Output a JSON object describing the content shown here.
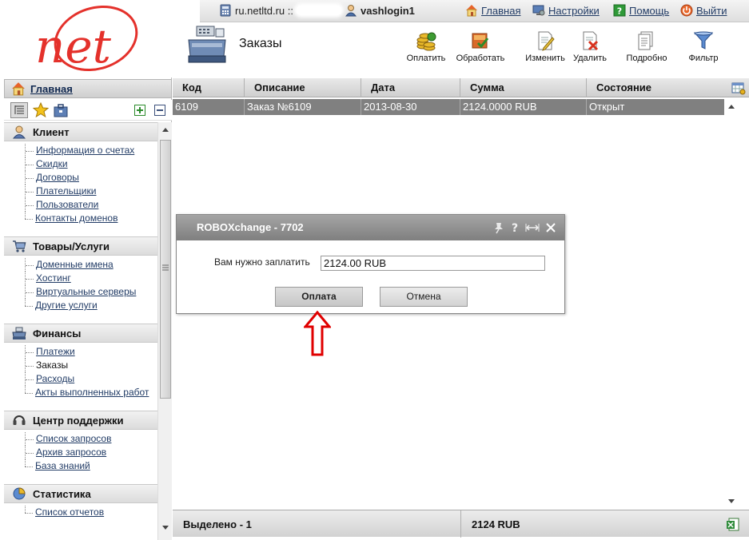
{
  "topbar": {
    "host": "ru.netltd.ru ::",
    "login": "vashlogin1",
    "home": "Главная",
    "settings": "Настройки",
    "help": "Помощь",
    "logout": "Выйти"
  },
  "page": {
    "title": "Заказы"
  },
  "toolbar": {
    "pay": "Оплатить",
    "process": "Обработать",
    "edit": "Изменить",
    "delete": "Удалить",
    "details": "Подробно",
    "filter": "Фильтр"
  },
  "sidebar": {
    "home": "Главная",
    "sections": [
      {
        "title": "Клиент",
        "items": [
          "Информация о счетах",
          "Скидки",
          "Договоры",
          "Плательщики",
          "Пользователи",
          "Контакты доменов"
        ]
      },
      {
        "title": "Товары/Услуги",
        "items": [
          "Доменные имена",
          "Хостинг",
          "Виртуальные серверы",
          "Другие услуги"
        ]
      },
      {
        "title": "Финансы",
        "items": [
          "Платежи",
          "Заказы",
          "Расходы",
          "Акты выполненных работ"
        ]
      },
      {
        "title": "Центр поддержки",
        "items": [
          "Список запросов",
          "Архив запросов",
          "База знаний"
        ]
      },
      {
        "title": "Статистика",
        "items": [
          "Список отчетов"
        ]
      }
    ]
  },
  "grid": {
    "columns": [
      "Код",
      "Описание",
      "Дата",
      "Сумма",
      "Состояние"
    ],
    "rows": [
      [
        "6109",
        "Заказ №6109",
        "2013-08-30",
        "2124.0000 RUB",
        "Открыт"
      ]
    ],
    "footer_selected": "Выделено - 1",
    "footer_total": "2124 RUB"
  },
  "dialog": {
    "title": "ROBOXchange - 7702",
    "label": "Вам нужно заплатить",
    "amount": "2124.00 RUB",
    "pay_button": "Оплата",
    "cancel_button": "Отмена"
  },
  "colors": {
    "logo_red": "#e4312b",
    "link": "#223c66",
    "selected_row": "#808080",
    "arrow": "#e00000"
  }
}
